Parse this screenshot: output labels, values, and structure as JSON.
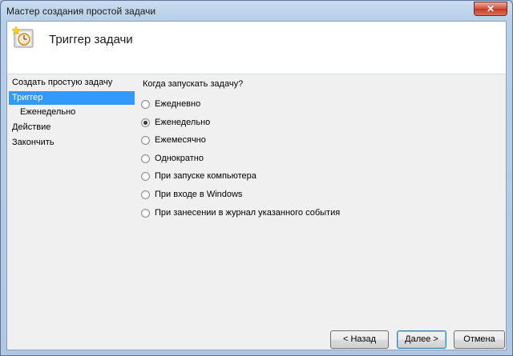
{
  "window": {
    "title": "Мастер создания простой задачи",
    "close_glyph": "✕"
  },
  "header": {
    "title": "Триггер задачи",
    "icon": "task-clock-icon"
  },
  "nav": {
    "items": [
      {
        "label": "Создать простую задачу",
        "selected": false,
        "indent": false
      },
      {
        "label": "Триггер",
        "selected": true,
        "indent": false
      },
      {
        "label": "Еженедельно",
        "selected": false,
        "indent": true
      },
      {
        "label": "Действие",
        "selected": false,
        "indent": false
      },
      {
        "label": "Закончить",
        "selected": false,
        "indent": false
      }
    ]
  },
  "main": {
    "question": "Когда запускать задачу?",
    "options": [
      {
        "label": "Ежедневно",
        "checked": false
      },
      {
        "label": "Еженедельно",
        "checked": true
      },
      {
        "label": "Ежемесячно",
        "checked": false
      },
      {
        "label": "Однократно",
        "checked": false
      },
      {
        "label": "При запуске компьютера",
        "checked": false
      },
      {
        "label": "При входе в Windows",
        "checked": false
      },
      {
        "label": "При занесении в журнал указанного события",
        "checked": false
      }
    ]
  },
  "buttons": {
    "back": "< Назад",
    "next": "Далее >",
    "cancel": "Отмена"
  },
  "colors": {
    "selection": "#3399ff",
    "close": "#c23a22"
  }
}
